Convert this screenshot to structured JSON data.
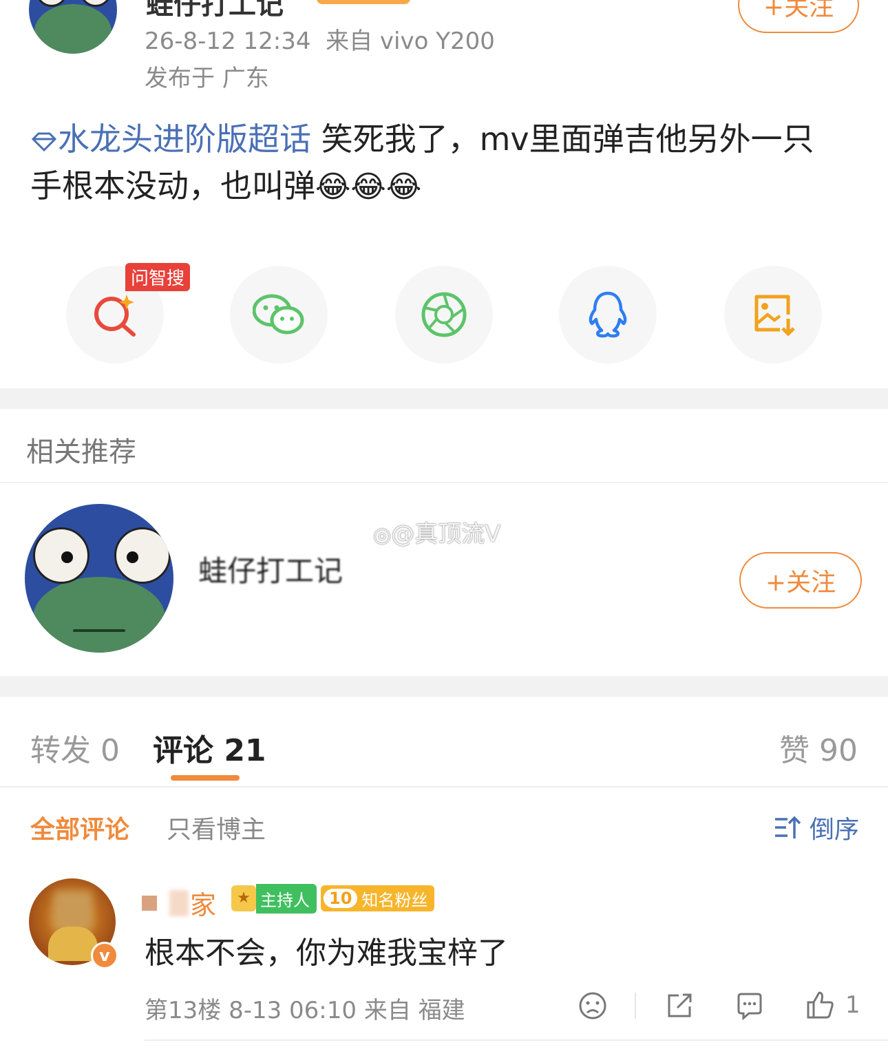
{
  "post": {
    "author_name": "蛙仔打工记",
    "timestamp": "26-8-12 12:34",
    "source": "来自 vivo Y200",
    "location": "发布于 广东",
    "follow_label": "+关注",
    "topic": "水龙头进阶版超话",
    "content_line1": "笑死我了，mv里面弹吉他另外一只",
    "content_line2": "手根本没动，也叫弹",
    "emoji": "😂😂😂"
  },
  "share": {
    "badge": "问智搜",
    "items": [
      "search-ai-icon",
      "wechat-icon",
      "moments-icon",
      "qq-icon",
      "save-image-icon"
    ]
  },
  "related": {
    "section_title": "相关推荐",
    "user_name": "蛙仔打工记",
    "follow_label": "+关注",
    "watermark": "@真顶流V"
  },
  "tabs": {
    "repost": "转发 0",
    "comments": "评论 21",
    "likes": "赞 90"
  },
  "filters": {
    "all": "全部评论",
    "author_only": "只看博主",
    "sort": "倒序"
  },
  "comment": {
    "user_name": "家",
    "badge_host": "主持人",
    "badge_fan_level": "10",
    "badge_fan": "知名粉丝",
    "text": "根本不会，你为难我宝梓了",
    "meta": "第13楼 8-13 06:10 来自 福建",
    "like_count": "1"
  },
  "colors": {
    "accent": "#f08a3c",
    "link": "#4a70b5",
    "meta": "#8a8a8a",
    "wechat": "#5cc46a",
    "qq": "#2f7ef0",
    "save": "#f2a21c",
    "ai_red": "#e84a3c"
  }
}
